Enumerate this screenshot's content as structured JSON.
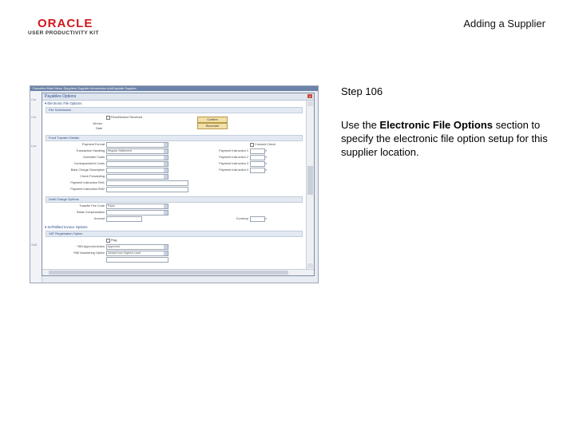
{
  "logo": {
    "word": "ORACLE",
    "sub": "USER PRODUCTIVITY KIT"
  },
  "slide": {
    "title": "Adding a Supplier",
    "step": "Step 106",
    "instruction_pre": "Use the ",
    "instruction_bold": "Electronic File Options",
    "instruction_post": " section to specify the electronic file option setup for this supplier location."
  },
  "shot": {
    "breadcrumb": "Favorites   Main Menu   Suppliers   Supplier Information   Add/Update   Supplier",
    "dialog_title": "Payables Options",
    "left_labels": [
      "Cur",
      "Cre",
      "Loc",
      "SetI"
    ],
    "sections": {
      "electronic": "Electronic File Options",
      "edi": "File Submission",
      "fund": "Fund Transfer Details",
      "draft": "Draft Charge Options",
      "ach": "Self-Billed Invoice Options",
      "vat": "VAT Registration Option"
    },
    "edi_fields": {
      "remit_label": "Remit/Advice Received",
      "vendor_label": "Vendor",
      "date_label": "Date",
      "btn1": "Confirm",
      "btn2": "Reconcile"
    },
    "fund_fields": {
      "payment_format": "Payment Format",
      "transaction_handling": "Transaction Handling",
      "transaction_value": "Regular Settlement",
      "domestic_costs": "Domestic Costs",
      "correspondent": "Correspondent's Costs",
      "bank_charge": "Bank Charge Description",
      "check_forwarding": "Check Forwarding",
      "pay_info1": "Payment Instruction Ref1",
      "pay_info2": "Payment Instruction Ref2",
      "crossed_check": "Crossed Check",
      "instr": [
        "Payment Instruction 1",
        "Payment Instruction 2",
        "Payment Instruction 3",
        "Payment Instruction 4"
      ]
    },
    "draft_fields": {
      "transfer": "Transfer Fee Code",
      "transfer_value": "Payer",
      "basis": "Basis Compensation",
      "amount": "Amount",
      "currency": "Currency"
    },
    "ach_fields": {
      "label": "Flag",
      "sbi_label": "*SBI Approval Action",
      "sbi_value": "Approved",
      "sbi_num_label": "*SBI Numbering Option",
      "sbi_num_value": "Default from Highest Level"
    }
  }
}
